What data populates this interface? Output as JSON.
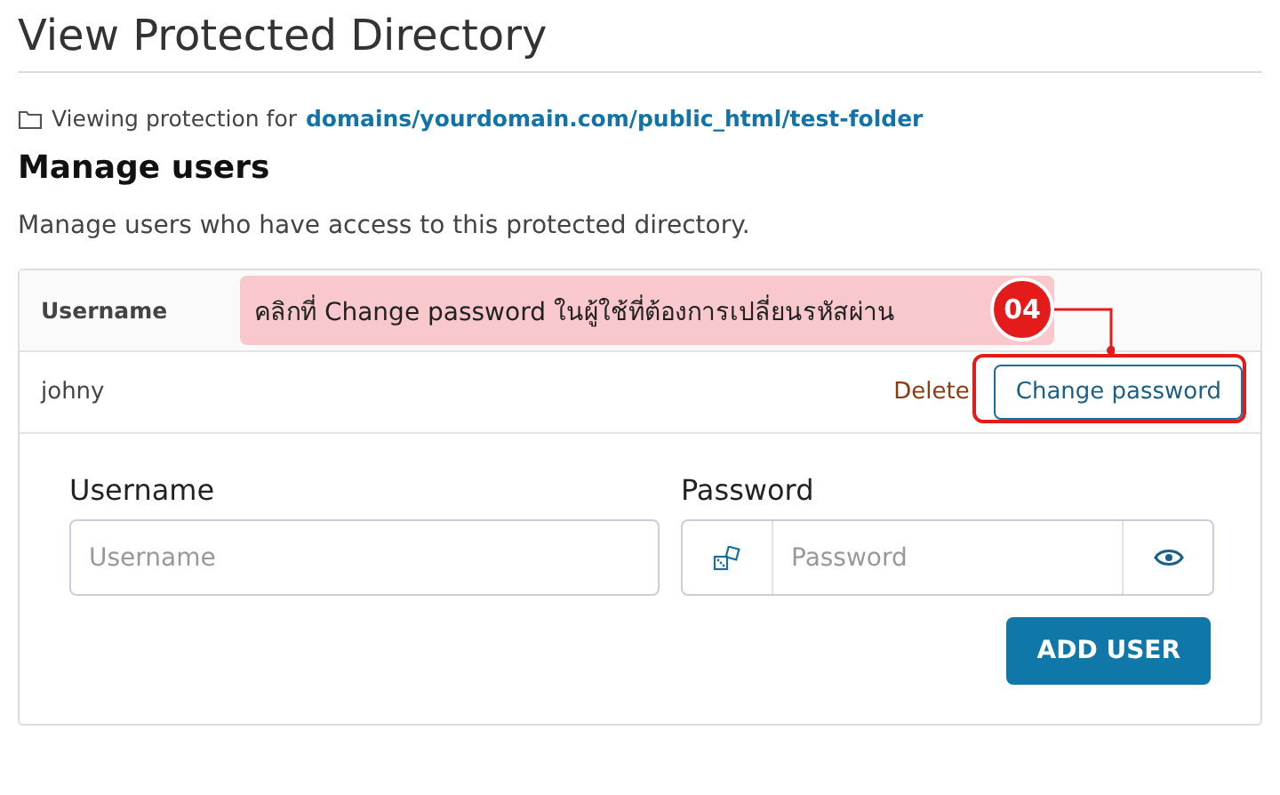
{
  "page_title": "View Protected Directory",
  "protection": {
    "prefix": "Viewing protection for",
    "path": "domains/yourdomain.com/public_html/test-folder"
  },
  "section": {
    "title": "Manage users",
    "description": "Manage users who have access to this protected directory."
  },
  "table": {
    "columns": [
      "Username"
    ],
    "rows": [
      {
        "username": "johny",
        "actions": [
          "Delete",
          "Change password"
        ]
      }
    ]
  },
  "form": {
    "username": {
      "label": "Username",
      "placeholder": "Username"
    },
    "password": {
      "label": "Password",
      "placeholder": "Password"
    },
    "submit": "ADD USER"
  },
  "annotation": {
    "step": "04",
    "text": "คลิกที่ Change password ในผู้ใช้ที่ต้องการเปลี่ยนรหัสผ่าน"
  }
}
